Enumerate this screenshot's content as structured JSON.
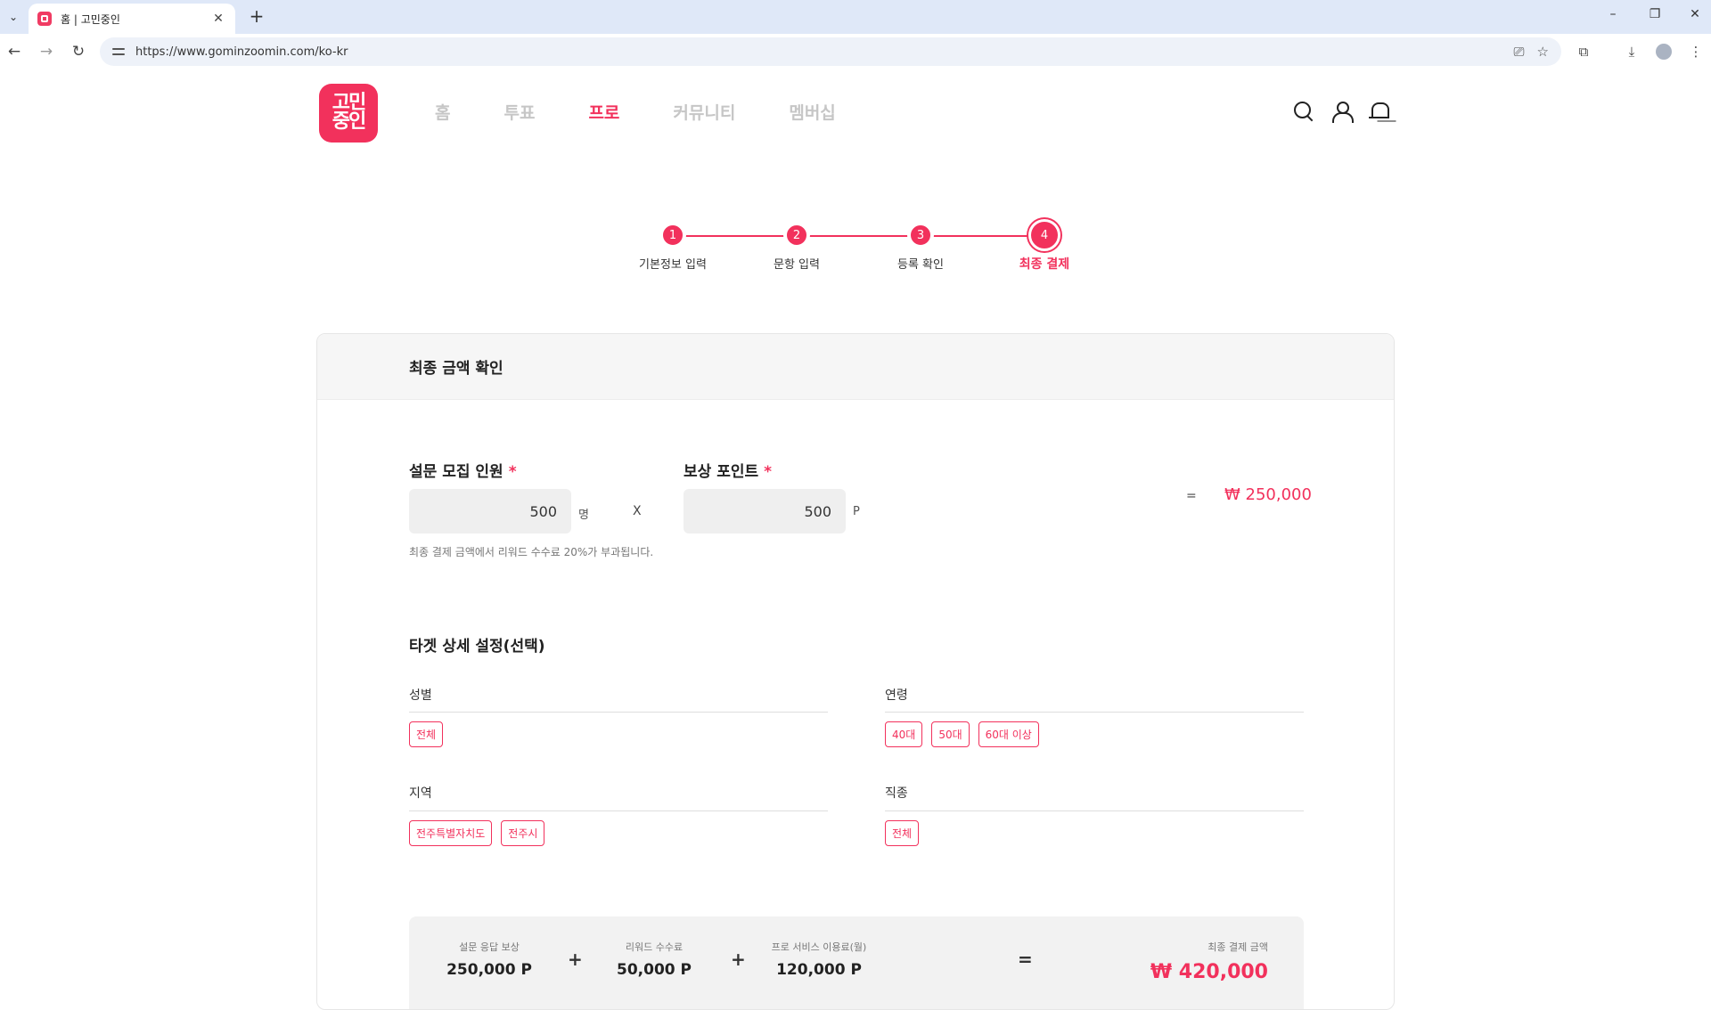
{
  "browser": {
    "tab_title": "홈 | 고민중인",
    "url": "https://www.gominzoomin.com/ko-kr"
  },
  "site": {
    "logo_text": [
      "고민",
      "중인"
    ],
    "nav": [
      "홈",
      "투표",
      "프로",
      "커뮤니티",
      "멤버십"
    ],
    "active_nav": "프로",
    "accent_color": "#f2315c"
  },
  "stepper": {
    "steps": [
      {
        "num": "1",
        "label": "기본정보 입력"
      },
      {
        "num": "2",
        "label": "문항 입력"
      },
      {
        "num": "3",
        "label": "등록 확인"
      },
      {
        "num": "4",
        "label": "최종 결제"
      }
    ],
    "current": 4
  },
  "final": {
    "title": "최종 금액 확인",
    "recruit_label": "설문 모집 인원",
    "recruit_value": "500",
    "recruit_unit": "명",
    "times": "X",
    "reward_label": "보상 포인트",
    "reward_value": "500",
    "reward_unit": "P",
    "equals": "=",
    "subtotal": "₩ 250,000",
    "required_mark": "*",
    "note": "최종 결제 금액에서 리워드 수수료 20%가 부과됩니다."
  },
  "target": {
    "title": "타겟 상세 설정(선택)",
    "gender": {
      "label": "성별",
      "chips": [
        "전체"
      ]
    },
    "age": {
      "label": "연령",
      "chips": [
        "40대",
        "50대",
        "60대 이상"
      ]
    },
    "region": {
      "label": "지역",
      "chips": [
        "전주특별자치도",
        "전주시"
      ]
    },
    "job": {
      "label": "직종",
      "chips": [
        "전체"
      ]
    }
  },
  "summary": {
    "items": [
      {
        "caption": "설문 응답 보상",
        "value": "250,000 P"
      },
      {
        "caption": "리워드 수수료",
        "value": "50,000 P"
      },
      {
        "caption": "프로 서비스 이용료(월)",
        "value": "120,000 P"
      }
    ],
    "plus": "+",
    "equals": "=",
    "total_caption": "최종 결제 금액",
    "total_value": "₩ 420,000"
  }
}
